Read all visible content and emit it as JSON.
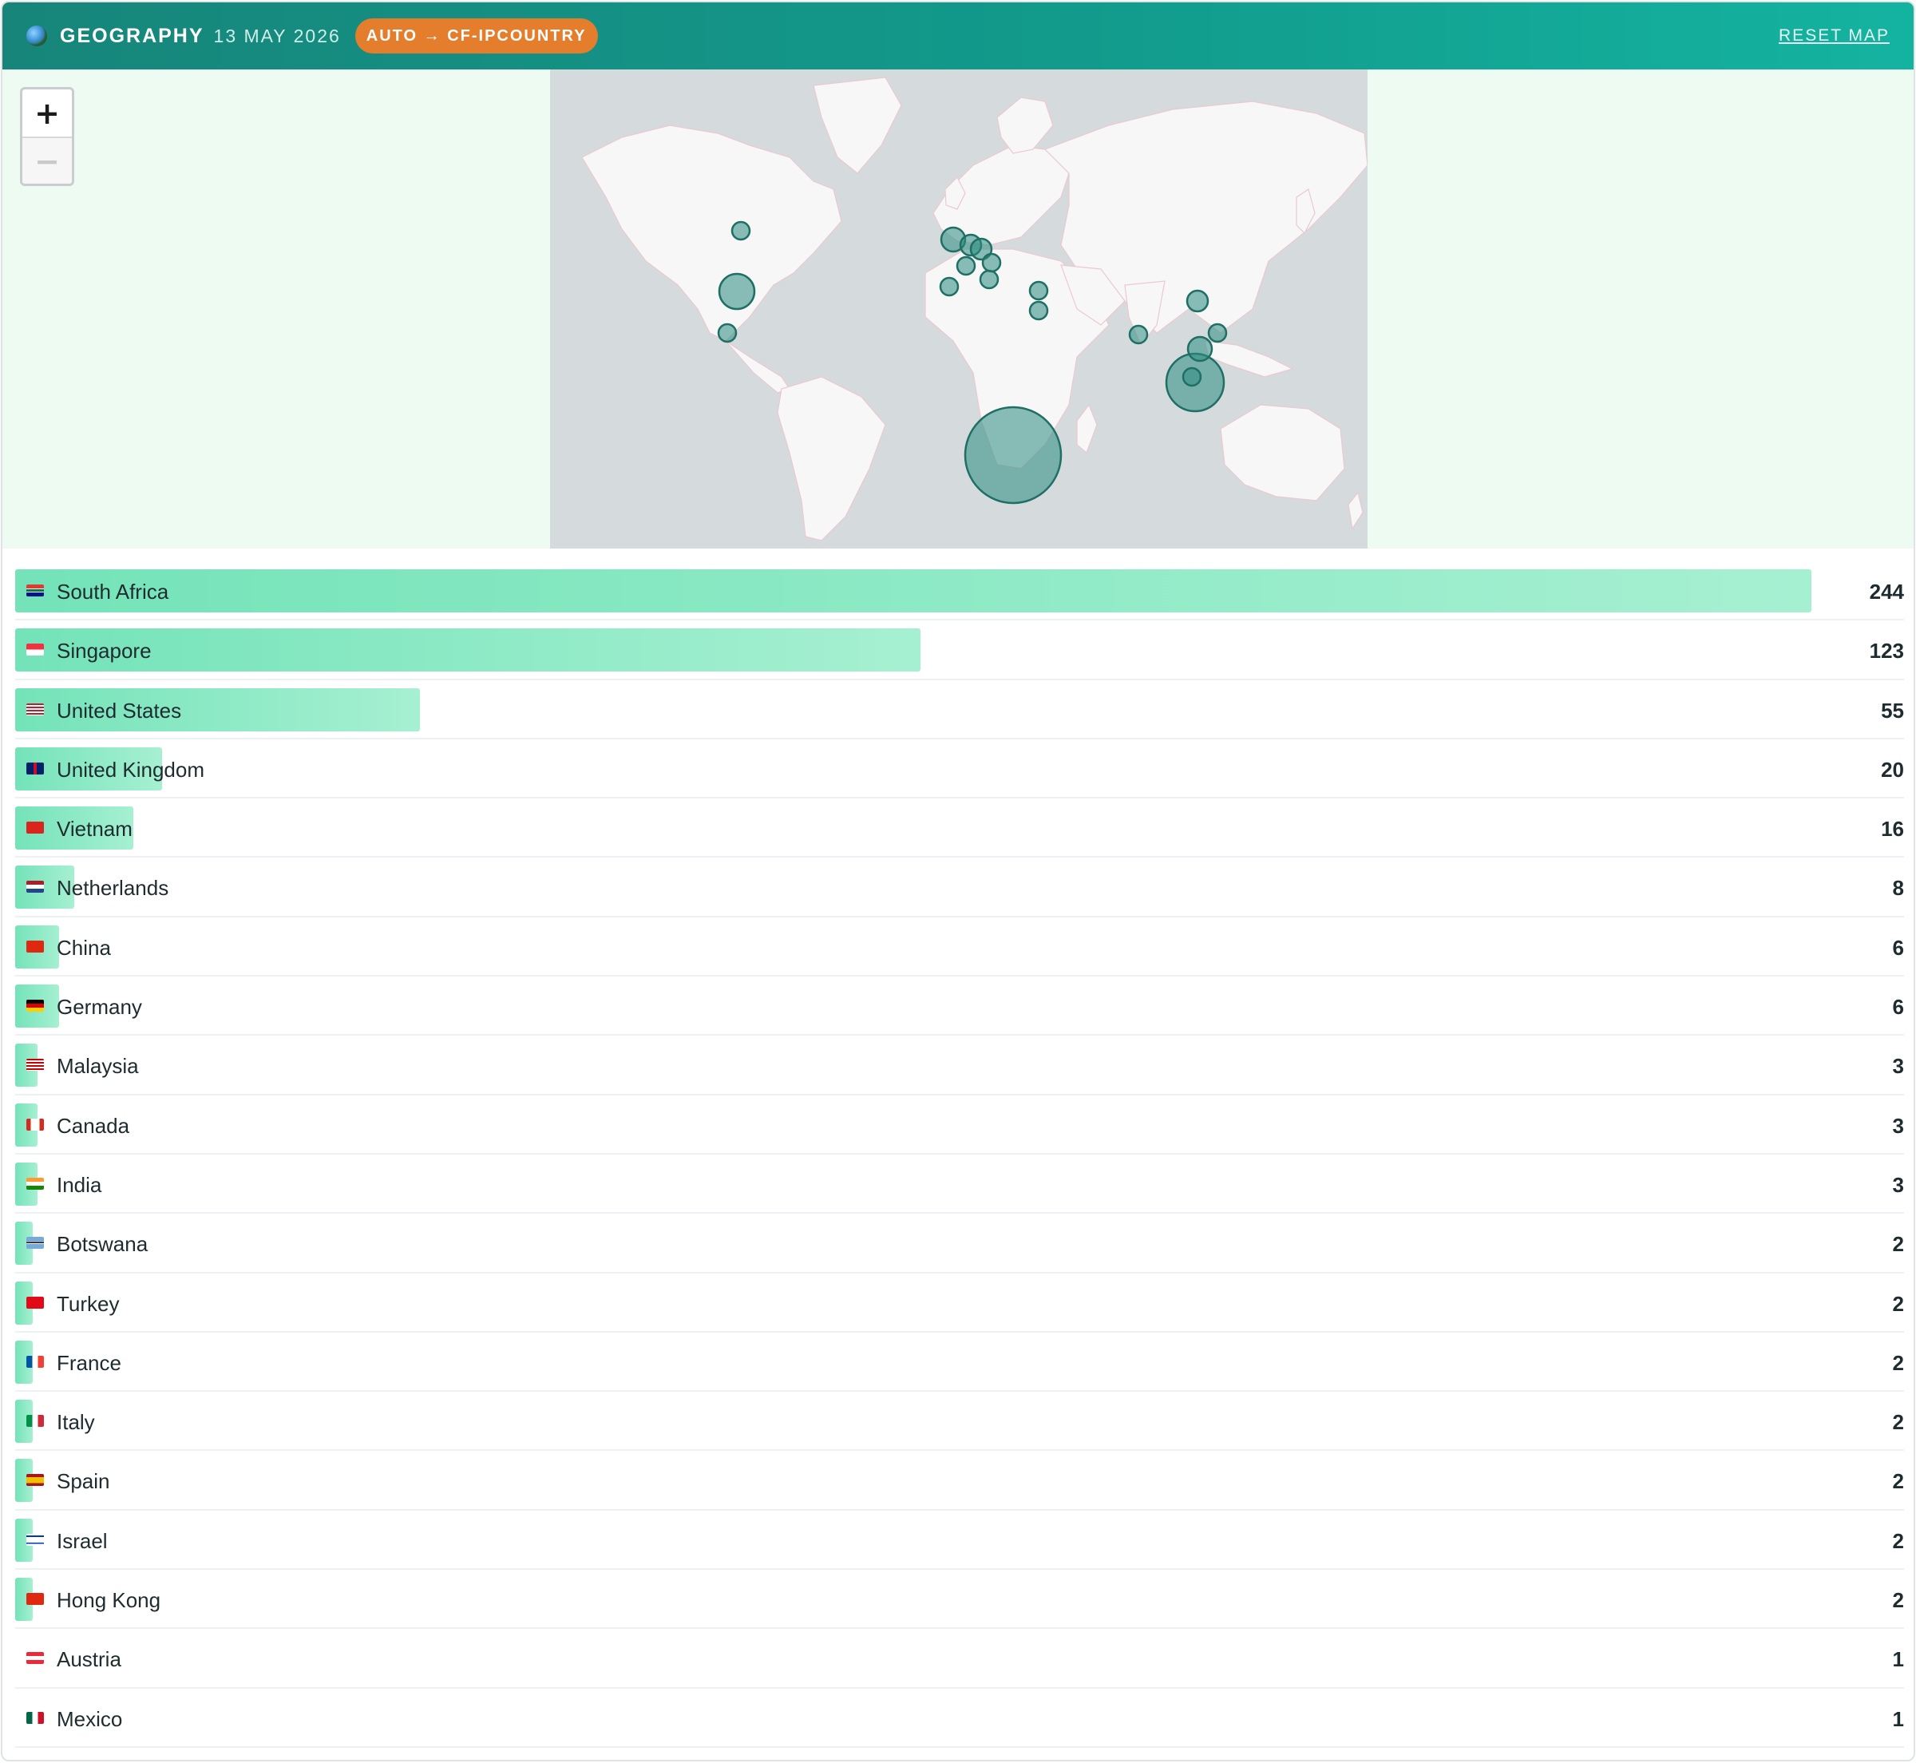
{
  "header": {
    "title": "GEOGRAPHY",
    "date": "13 MAY 2026",
    "badge": "AUTO → CF-IPCOUNTRY",
    "reset_label": "RESET MAP"
  },
  "zoom": {
    "in_label": "+",
    "out_label": "−"
  },
  "colors": {
    "accent": "#17857a",
    "badge": "#e47d2c",
    "bubble": "#2a8c80",
    "bar_start": "#74e3b9",
    "bar_end": "#a6f0d2"
  },
  "countries": [
    {
      "name": "South Africa",
      "count": "244",
      "value": 244,
      "flag": "flag-za"
    },
    {
      "name": "Singapore",
      "count": "123",
      "value": 123,
      "flag": "flag-sg"
    },
    {
      "name": "United States",
      "count": "55",
      "value": 55,
      "flag": "flag-us"
    },
    {
      "name": "United Kingdom",
      "count": "20",
      "value": 20,
      "flag": "flag-gb"
    },
    {
      "name": "Vietnam",
      "count": "16",
      "value": 16,
      "flag": "flag-vn"
    },
    {
      "name": "Netherlands",
      "count": "8",
      "value": 8,
      "flag": "flag-nl"
    },
    {
      "name": "China",
      "count": "6",
      "value": 6,
      "flag": "flag-cn"
    },
    {
      "name": "Germany",
      "count": "6",
      "value": 6,
      "flag": "flag-de"
    },
    {
      "name": "Malaysia",
      "count": "3",
      "value": 3,
      "flag": "flag-my"
    },
    {
      "name": "Canada",
      "count": "3",
      "value": 3,
      "flag": "flag-ca"
    },
    {
      "name": "India",
      "count": "3",
      "value": 3,
      "flag": "flag-in"
    },
    {
      "name": "Botswana",
      "count": "2",
      "value": 2,
      "flag": "flag-bw"
    },
    {
      "name": "Turkey",
      "count": "2",
      "value": 2,
      "flag": "flag-tr"
    },
    {
      "name": "France",
      "count": "2",
      "value": 2,
      "flag": "flag-fr"
    },
    {
      "name": "Italy",
      "count": "2",
      "value": 2,
      "flag": "flag-it"
    },
    {
      "name": "Spain",
      "count": "2",
      "value": 2,
      "flag": "flag-es"
    },
    {
      "name": "Israel",
      "count": "2",
      "value": 2,
      "flag": "flag-il"
    },
    {
      "name": "Hong Kong",
      "count": "2",
      "value": 2,
      "flag": "flag-hk"
    },
    {
      "name": "Austria",
      "count": "1",
      "value": 1,
      "flag": "flag-at"
    },
    {
      "name": "Mexico",
      "count": "1",
      "value": 1,
      "flag": "flag-mx"
    }
  ]
}
